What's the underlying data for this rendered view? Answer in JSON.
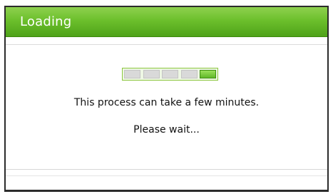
{
  "dialog": {
    "title": "Loading",
    "message": "This process can take a few minutes.",
    "wait_text": "Please wait..."
  },
  "progress": {
    "segments_total": 5,
    "active_segment": 5,
    "accent_color": "#6cbf2c"
  }
}
